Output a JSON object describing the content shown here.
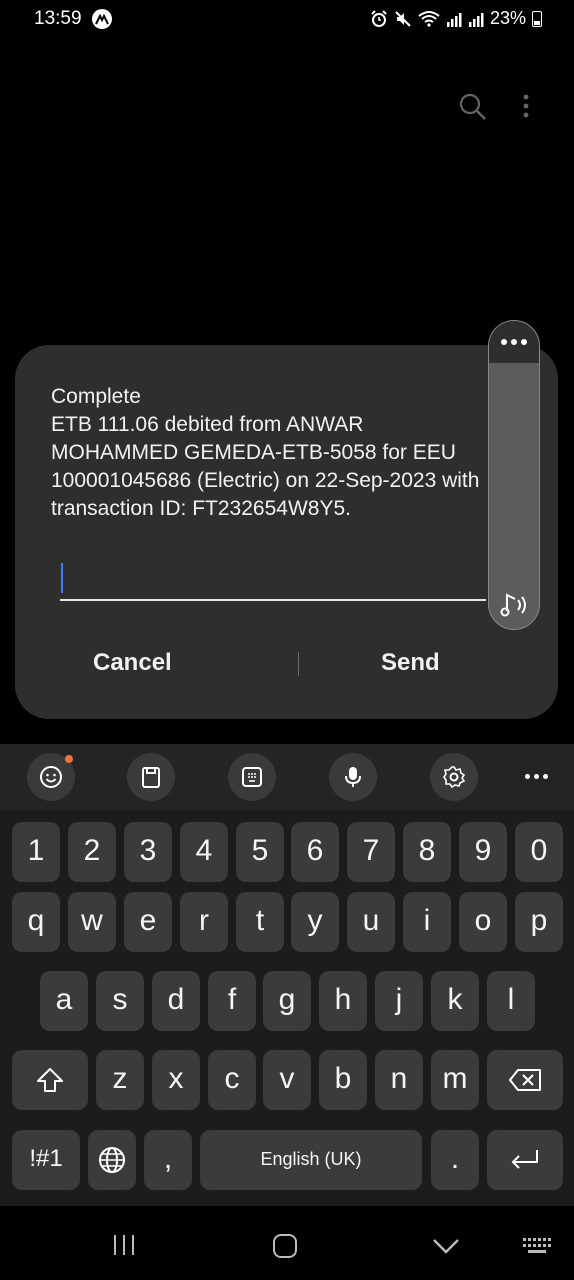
{
  "status_bar": {
    "time": "13:59",
    "battery": "23%"
  },
  "dialog": {
    "message": "Complete\nETB 111.06 debited from ANWAR MOHAMMED GEMEDA-ETB-5058 for EEU 100001045686 (Electric) on 22-Sep-2023 with transaction ID: FT232654W8Y5.",
    "input_value": "",
    "cancel_label": "Cancel",
    "send_label": "Send"
  },
  "keyboard": {
    "number_row": [
      "1",
      "2",
      "3",
      "4",
      "5",
      "6",
      "7",
      "8",
      "9",
      "0"
    ],
    "row1": [
      "q",
      "w",
      "e",
      "r",
      "t",
      "y",
      "u",
      "i",
      "o",
      "p"
    ],
    "row2": [
      "a",
      "s",
      "d",
      "f",
      "g",
      "h",
      "j",
      "k",
      "l"
    ],
    "row3": [
      "z",
      "x",
      "c",
      "v",
      "b",
      "n",
      "m"
    ],
    "symbols_label": "!#1",
    "comma_label": ",",
    "space_label": "English (UK)",
    "period_label": "."
  },
  "colors": {
    "accent_cursor": "#3d7bff",
    "notification_dot": "#f0733c"
  }
}
